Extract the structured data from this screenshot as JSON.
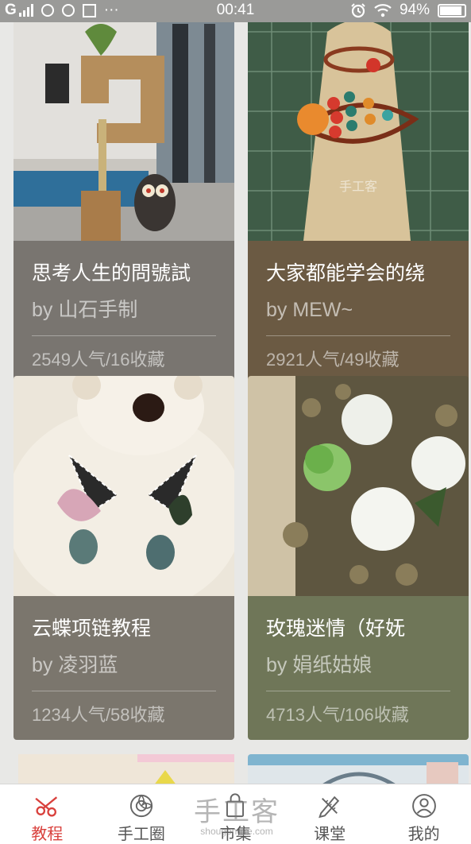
{
  "status_bar": {
    "network": "G",
    "time": "00:41",
    "battery": "94%",
    "more": "···"
  },
  "cards": [
    {
      "title": "思考人生的問號試",
      "author": "by 山石手制",
      "stats": "2549人气/16收藏",
      "bg": "#797570"
    },
    {
      "title": "大家都能学会的绕",
      "author": "by MEW~",
      "stats": "2921人气/49收藏",
      "bg": "#6b5a43"
    },
    {
      "title": "云蝶项链教程",
      "author": "by 凌羽蓝",
      "stats": "1234人气/58收藏",
      "bg": "#7b766d"
    },
    {
      "title": "玫瑰迷情（好妩",
      "author": "by 娟纸姑娘",
      "stats": "4713人气/106收藏",
      "bg": "#6f7658"
    }
  ],
  "photo_watermark": "手工客",
  "tabbar": {
    "tabs": [
      {
        "label": "教程",
        "icon": "scissors-icon",
        "active": true
      },
      {
        "label": "手工圈",
        "icon": "flower-icon",
        "active": false
      },
      {
        "label": "市集",
        "icon": "shopping-bag-icon",
        "active": false
      },
      {
        "label": "课堂",
        "icon": "pencil-ruler-icon",
        "active": false
      },
      {
        "label": "我的",
        "icon": "user-icon",
        "active": false
      }
    ]
  },
  "watermark": {
    "main": "手工客",
    "sub": "shougongke.com"
  },
  "colors": {
    "accent": "#d9413d",
    "status_bar": "#9a9a98",
    "background": "#e8e8e6"
  }
}
